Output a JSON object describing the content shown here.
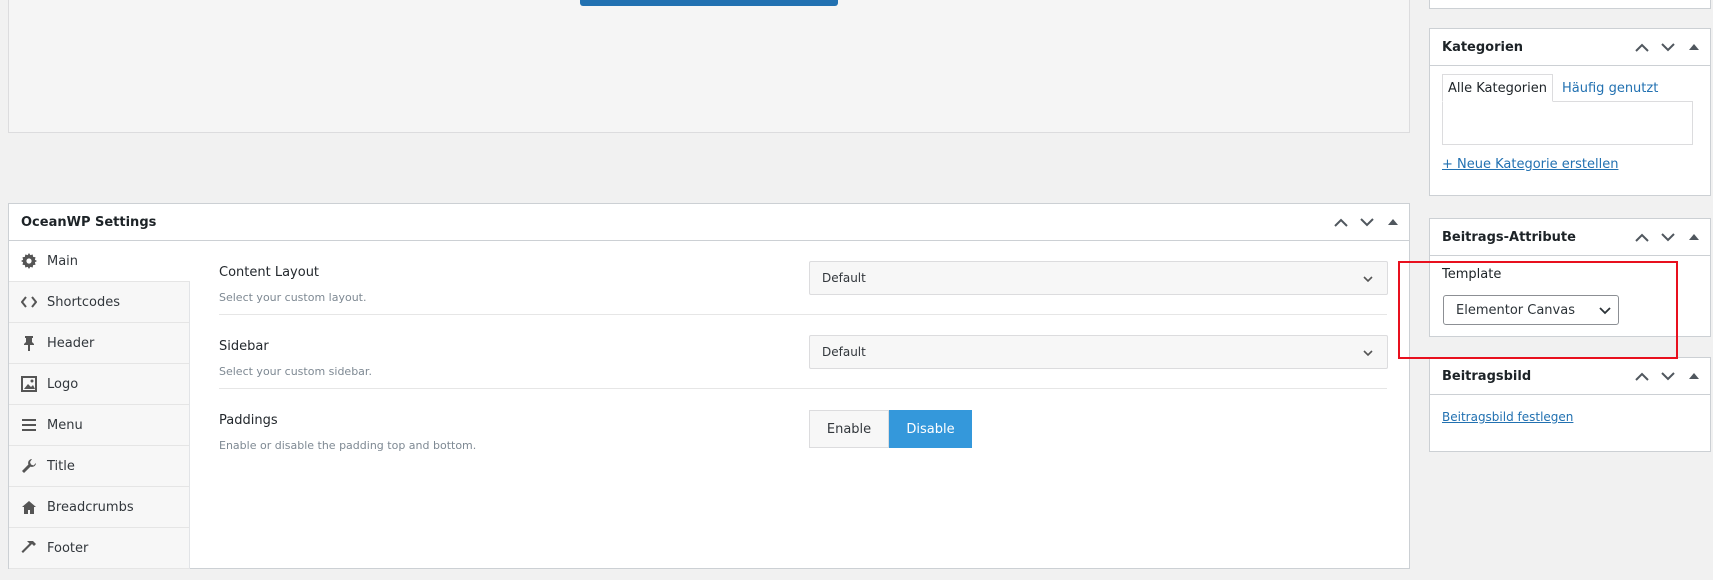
{
  "oceanwp": {
    "title": "OceanWP Settings",
    "nav": [
      {
        "label": "Main",
        "icon": "gear-icon"
      },
      {
        "label": "Shortcodes",
        "icon": "code-icon"
      },
      {
        "label": "Header",
        "icon": "pin-icon"
      },
      {
        "label": "Logo",
        "icon": "image-icon"
      },
      {
        "label": "Menu",
        "icon": "menu-icon"
      },
      {
        "label": "Title",
        "icon": "wrench-icon"
      },
      {
        "label": "Breadcrumbs",
        "icon": "home-icon"
      },
      {
        "label": "Footer",
        "icon": "hammer-icon"
      }
    ],
    "content_layout": {
      "label": "Content Layout",
      "desc": "Select your custom layout.",
      "value": "Default"
    },
    "sidebar": {
      "label": "Sidebar",
      "desc": "Select your custom sidebar.",
      "value": "Default"
    },
    "paddings": {
      "label": "Paddings",
      "desc": "Enable or disable the padding top and bottom.",
      "enable": "Enable",
      "disable": "Disable",
      "selected": "Disable"
    }
  },
  "kategorien": {
    "title": "Kategorien",
    "tabs": [
      "Alle Kategorien",
      "Häufig genutzt"
    ],
    "add_link": "+ Neue Kategorie erstellen"
  },
  "attribute": {
    "title": "Beitrags-Attribute",
    "template_label": "Template",
    "template_value": "Elementor Canvas"
  },
  "beitragsbild": {
    "title": "Beitragsbild",
    "link": "Beitragsbild festlegen"
  },
  "colors": {
    "accent": "#3498db",
    "link": "#2271b1",
    "highlight": "#e8101e"
  }
}
